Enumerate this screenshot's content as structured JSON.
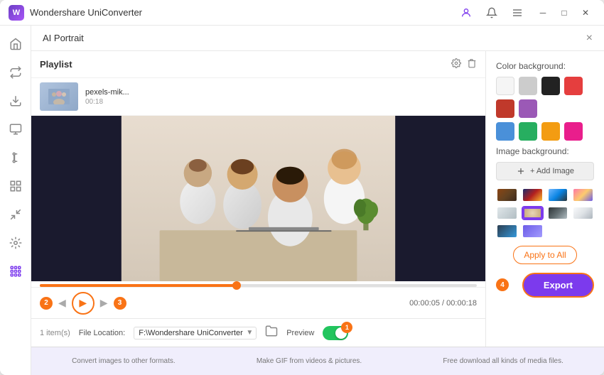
{
  "app": {
    "title": "Wondershare UniConverter",
    "logo_text": "W"
  },
  "title_bar": {
    "icons": [
      "user-icon",
      "bell-icon",
      "menu-icon"
    ],
    "win_controls": [
      "minimize",
      "maximize",
      "close"
    ]
  },
  "sidebar": {
    "items": [
      {
        "id": "home",
        "icon": "⌂",
        "label": "Home"
      },
      {
        "id": "convert",
        "icon": "⇄",
        "label": "Convert"
      },
      {
        "id": "download",
        "icon": "↓",
        "label": "Download"
      },
      {
        "id": "screen",
        "icon": "▣",
        "label": "Screen Recorder"
      },
      {
        "id": "edit",
        "icon": "✂",
        "label": "Edit"
      },
      {
        "id": "merge",
        "icon": "⊞",
        "label": "Merge"
      },
      {
        "id": "compress",
        "icon": "◫",
        "label": "Compress"
      },
      {
        "id": "watermark",
        "icon": "◈",
        "label": "Watermark"
      },
      {
        "id": "toolbox",
        "icon": "⊞",
        "label": "Toolbox"
      },
      {
        "id": "ai",
        "icon": "⠿",
        "label": "AI Tools",
        "active": true
      }
    ]
  },
  "ai_panel": {
    "title": "AI Portrait",
    "close_label": "×"
  },
  "playlist": {
    "title": "Playlist",
    "items": [
      {
        "name": "pexels-mik...",
        "duration": "00:18",
        "thumb_color": "#b0c0d0"
      }
    ]
  },
  "video": {
    "progress_pct": 45,
    "time_current": "00:00:05",
    "time_total": "00:00:18"
  },
  "controls": {
    "badge_2": "2",
    "badge_3": "3",
    "play_label": "▶",
    "prev_label": "◀",
    "next_label": "▶",
    "items_count": "1 item(s)"
  },
  "bottom_bar": {
    "file_location_label": "File Location:",
    "file_location_value": "F:\\Wondershare UniConverter",
    "preview_label": "Preview",
    "toggle_on": true,
    "badge_1": "1"
  },
  "right_panel": {
    "color_bg_label": "Color background:",
    "colors": [
      {
        "hex": "#f5f5f5",
        "label": "white"
      },
      {
        "hex": "#e8e8e8",
        "label": "light-gray"
      },
      {
        "hex": "#222222",
        "label": "black"
      },
      {
        "hex": "#e53e3e",
        "label": "red"
      },
      {
        "hex": "#c0392b",
        "label": "dark-red"
      },
      {
        "hex": "#9b59b6",
        "label": "purple"
      },
      {
        "hex": "#4a90d9",
        "label": "blue"
      },
      {
        "hex": "#27ae60",
        "label": "green"
      },
      {
        "hex": "#f39c12",
        "label": "orange"
      },
      {
        "hex": "#e91e8c",
        "label": "pink"
      }
    ],
    "image_bg_label": "Image background:",
    "add_image_label": "+ Add Image",
    "bg_thumbs": [
      {
        "class": "bg-t1",
        "label": "wood"
      },
      {
        "class": "bg-t2",
        "label": "galaxy"
      },
      {
        "class": "bg-t3",
        "label": "blue-sky"
      },
      {
        "class": "bg-t4",
        "label": "sunset"
      },
      {
        "class": "bg-t5",
        "label": "gray"
      },
      {
        "class": "bg-t6",
        "label": "beige",
        "active": true
      },
      {
        "class": "bg-t7",
        "label": "dark"
      },
      {
        "class": "bg-t8",
        "label": "office"
      },
      {
        "class": "bg-t9",
        "label": "night"
      },
      {
        "class": "bg-t10",
        "label": "purple-room"
      }
    ],
    "apply_all_label": "Apply to All",
    "export_label": "Export",
    "badge_4": "4"
  },
  "footer": {
    "features": [
      "Convert images to other formats.",
      "Make GIF from videos & pictures.",
      "Free download all kinds of media files."
    ]
  }
}
